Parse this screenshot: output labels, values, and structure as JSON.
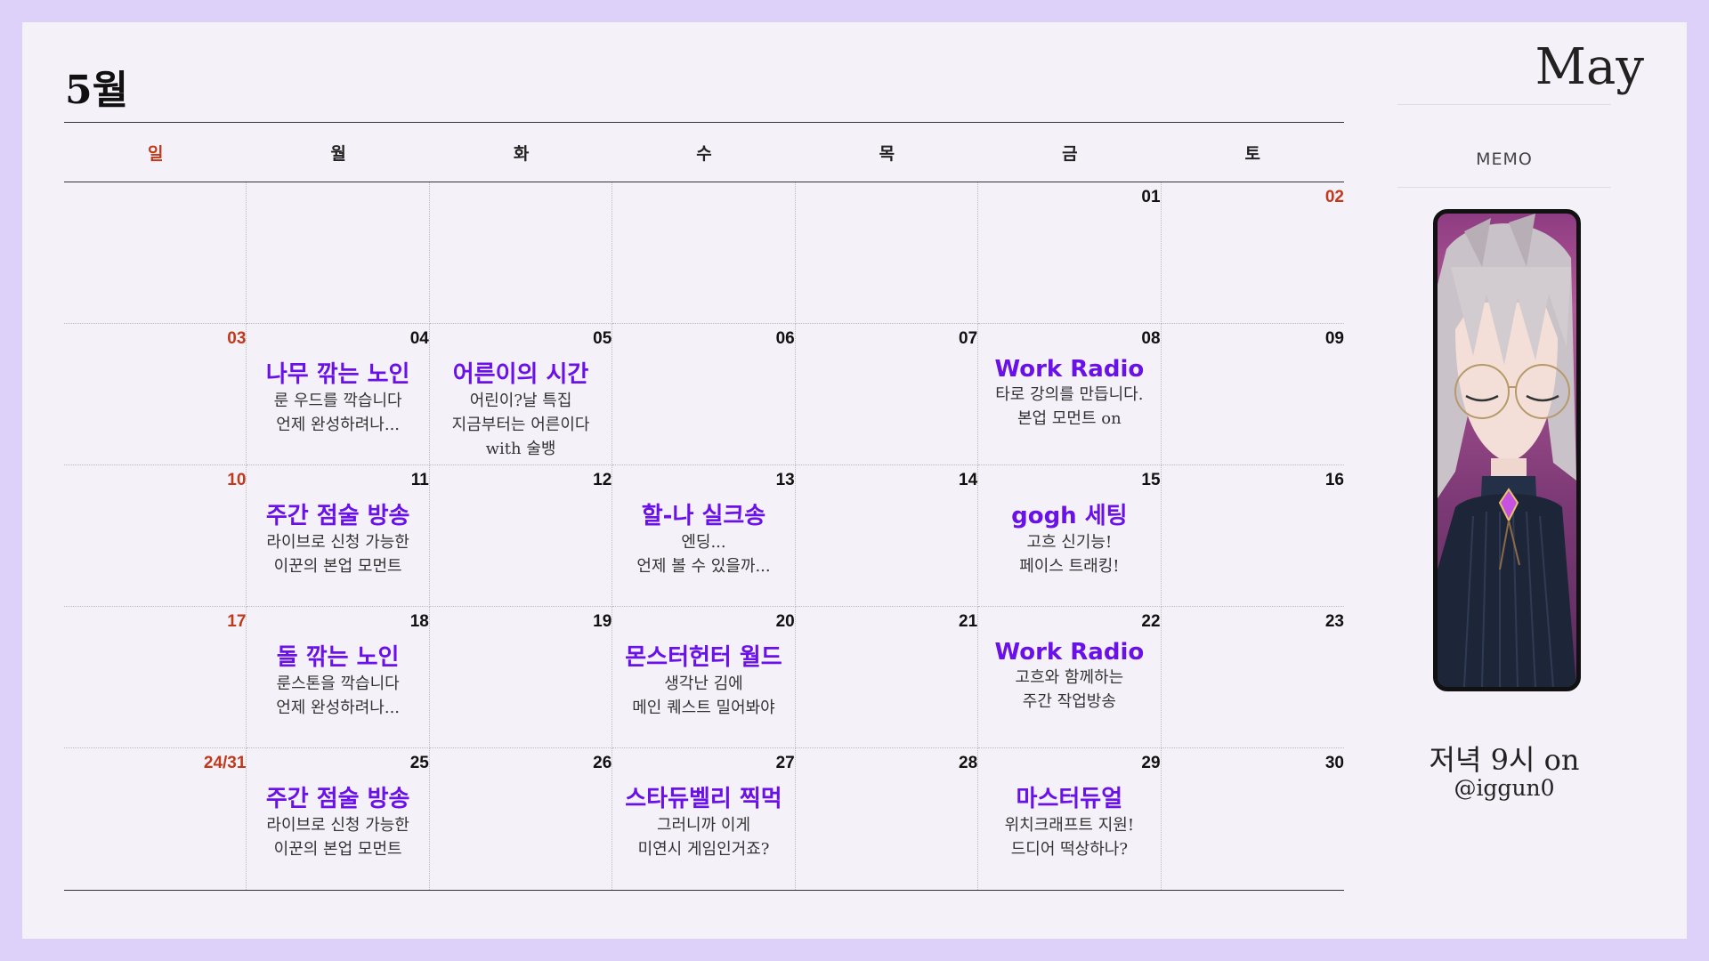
{
  "header": {
    "month_ko": "5월",
    "month_en": "May"
  },
  "weekdays": [
    "일",
    "월",
    "화",
    "수",
    "목",
    "금",
    "토"
  ],
  "weeks": [
    [
      {
        "day": "",
        "red": false,
        "title": "",
        "lines": []
      },
      {
        "day": "",
        "red": false,
        "title": "",
        "lines": []
      },
      {
        "day": "",
        "red": false,
        "title": "",
        "lines": []
      },
      {
        "day": "",
        "red": false,
        "title": "",
        "lines": []
      },
      {
        "day": "",
        "red": false,
        "title": "",
        "lines": []
      },
      {
        "day": "01",
        "red": false,
        "title": "",
        "lines": []
      },
      {
        "day": "02",
        "red": true,
        "title": "",
        "lines": []
      }
    ],
    [
      {
        "day": "03",
        "red": true,
        "title": "",
        "lines": []
      },
      {
        "day": "04",
        "red": false,
        "title": "나무 깎는 노인",
        "lines": [
          "룬 우드를 깍습니다",
          "언제 완성하려나..."
        ]
      },
      {
        "day": "05",
        "red": false,
        "title": "어른이의 시간",
        "lines": [
          "어린이?날 특집",
          "지금부터는 어른이다",
          "with 술뱅"
        ]
      },
      {
        "day": "06",
        "red": false,
        "title": "",
        "lines": []
      },
      {
        "day": "07",
        "red": false,
        "title": "",
        "lines": []
      },
      {
        "day": "08",
        "red": false,
        "title": "Work Radio",
        "lines": [
          "타로 강의를 만듭니다.",
          "본업 모먼트 on"
        ]
      },
      {
        "day": "09",
        "red": false,
        "title": "",
        "lines": []
      }
    ],
    [
      {
        "day": "10",
        "red": true,
        "title": "",
        "lines": []
      },
      {
        "day": "11",
        "red": false,
        "title": "주간 점술 방송",
        "lines": [
          "라이브로 신청 가능한",
          "이꾼의 본업 모먼트"
        ]
      },
      {
        "day": "12",
        "red": false,
        "title": "",
        "lines": []
      },
      {
        "day": "13",
        "red": false,
        "title": "할-나 실크송",
        "lines": [
          "엔딩...",
          "언제 볼 수 있을까..."
        ]
      },
      {
        "day": "14",
        "red": false,
        "title": "",
        "lines": []
      },
      {
        "day": "15",
        "red": false,
        "title": "gogh 세팅",
        "lines": [
          "고흐 신기능!",
          "페이스 트래킹!"
        ]
      },
      {
        "day": "16",
        "red": false,
        "title": "",
        "lines": []
      }
    ],
    [
      {
        "day": "17",
        "red": true,
        "title": "",
        "lines": []
      },
      {
        "day": "18",
        "red": false,
        "title": "돌 깎는 노인",
        "lines": [
          "룬스톤을 깍습니다",
          "언제 완성하려나..."
        ]
      },
      {
        "day": "19",
        "red": false,
        "title": "",
        "lines": []
      },
      {
        "day": "20",
        "red": false,
        "title": "몬스터헌터 월드",
        "lines": [
          "생각난 김에",
          "메인 퀘스트 밀어봐야"
        ]
      },
      {
        "day": "21",
        "red": false,
        "title": "",
        "lines": []
      },
      {
        "day": "22",
        "red": false,
        "title": "Work Radio",
        "lines": [
          "고흐와 함께하는",
          "주간 작업방송"
        ]
      },
      {
        "day": "23",
        "red": false,
        "title": "",
        "lines": []
      }
    ],
    [
      {
        "day": "24/31",
        "red": true,
        "title": "",
        "lines": []
      },
      {
        "day": "25",
        "red": false,
        "title": "주간 점술 방송",
        "lines": [
          "라이브로 신청 가능한",
          "이꾼의 본업 모먼트"
        ]
      },
      {
        "day": "26",
        "red": false,
        "title": "",
        "lines": []
      },
      {
        "day": "27",
        "red": false,
        "title": "스타듀벨리 찍먹",
        "lines": [
          "그러니까 이게",
          "미연시 게임인거죠?"
        ]
      },
      {
        "day": "28",
        "red": false,
        "title": "",
        "lines": []
      },
      {
        "day": "29",
        "red": false,
        "title": "마스터듀얼",
        "lines": [
          "위치크래프트 지원!",
          "드디어 떡상하나?"
        ]
      },
      {
        "day": "30",
        "red": false,
        "title": "",
        "lines": []
      }
    ]
  ],
  "sidebar": {
    "memo_label": "MEMO",
    "time_label": "저녁 9시 on",
    "handle": "@iggun0"
  },
  "colors": {
    "accent": "#6a10e8",
    "sunday": "#c0391b",
    "frame": "#ddd0f9",
    "paper": "#f4f2f8"
  }
}
